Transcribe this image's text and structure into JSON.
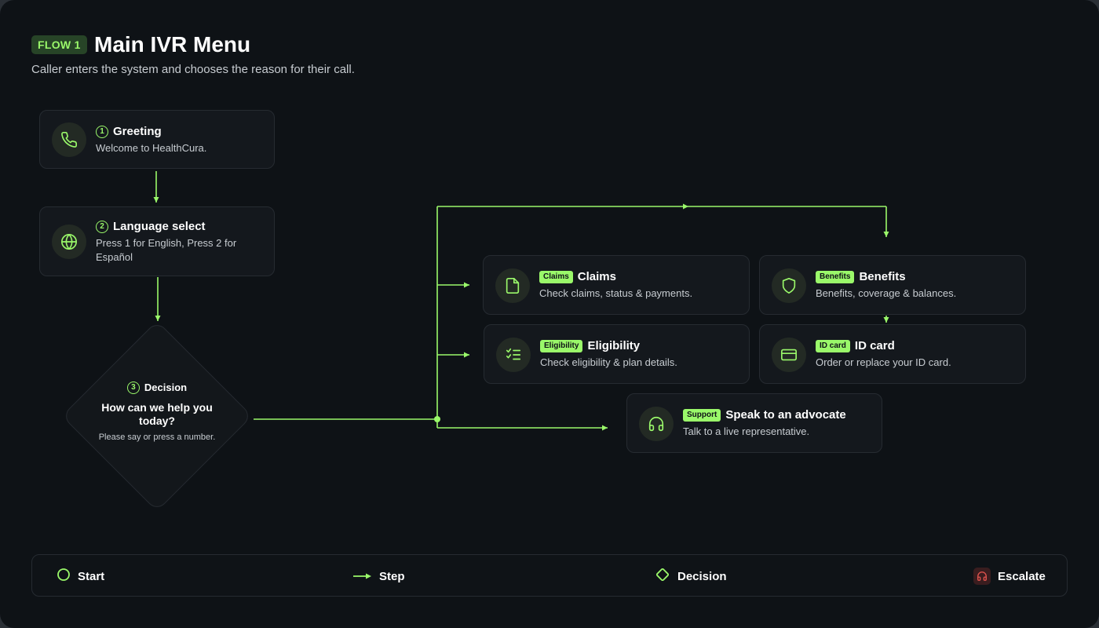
{
  "header": {
    "flow_badge": "FLOW 1",
    "title": "Main IVR Menu",
    "subtitle": "Caller enters the system and chooses the reason for their call."
  },
  "steps": [
    {
      "num": "1",
      "title": "Greeting",
      "desc": "Welcome to HealthCura.",
      "icon": "phone-icon"
    },
    {
      "num": "2",
      "title": "Language select",
      "desc": "Press 1 for English, Press 2 for Español",
      "icon": "globe-icon"
    }
  ],
  "decision": {
    "num": "3",
    "title": "Decision",
    "question": "How can we help you today?",
    "sub": "Please say or press a number."
  },
  "options": [
    {
      "tag": "Claims",
      "title": "Claims",
      "desc": "Check claims, status & payments.",
      "icon": "document-icon"
    },
    {
      "tag": "Benefits",
      "title": "Benefits",
      "desc": "Benefits, coverage & balances.",
      "icon": "shield-icon"
    },
    {
      "tag": "Eligibility",
      "title": "Eligibility",
      "desc": "Check eligibility & plan details.",
      "icon": "checklist-icon"
    },
    {
      "tag": "ID card",
      "title": "ID card",
      "desc": "Order or replace your ID card.",
      "icon": "id-card-icon"
    },
    {
      "tag": "Support",
      "title": "Speak to an advocate",
      "desc": "Talk to a live representative.",
      "icon": "headset-icon"
    }
  ],
  "legend": {
    "start": "Start",
    "step": "Step",
    "decision": "Decision",
    "escalate": "Escalate"
  },
  "colors": {
    "accent": "#9af86a",
    "background": "#0e1216",
    "card": "#14181d",
    "escalate": "#e2544f"
  }
}
